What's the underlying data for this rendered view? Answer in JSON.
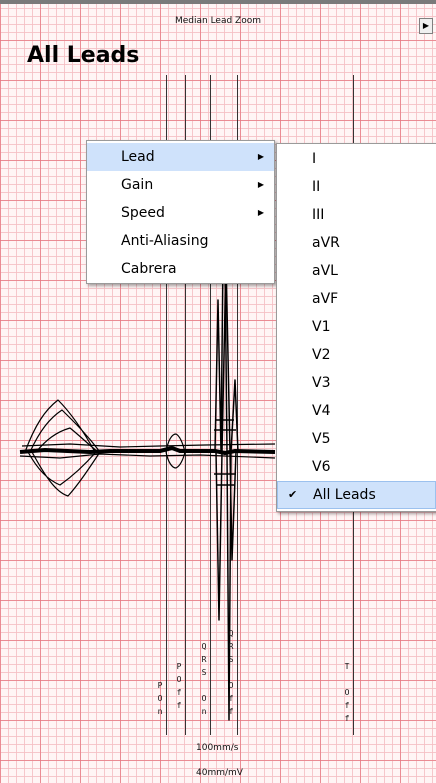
{
  "window": {
    "caption": "Median Lead Zoom",
    "nav_button": "▶",
    "title": "All Leads"
  },
  "markers": [
    {
      "id": "p-on",
      "label": "P\nO\nn"
    },
    {
      "id": "p-off",
      "label": "P\nO\nf\nf"
    },
    {
      "id": "qrs-on",
      "label": "Q\nR\nS\n\nO\nn"
    },
    {
      "id": "qrs-off",
      "label": "Q\nR\nS\n\nO\nf\nf"
    },
    {
      "id": "t-off",
      "label": "T\n\nO\nf\nf"
    }
  ],
  "scale": {
    "speed": "100mm/s",
    "gain": "40mm/mV"
  },
  "context_menu": {
    "items": [
      {
        "label": "Lead",
        "has_submenu": true,
        "selected": true
      },
      {
        "label": "Gain",
        "has_submenu": true,
        "selected": false
      },
      {
        "label": "Speed",
        "has_submenu": true,
        "selected": false
      },
      {
        "label": "Anti-Aliasing",
        "has_submenu": false,
        "selected": false
      },
      {
        "label": "Cabrera",
        "has_submenu": false,
        "selected": false
      }
    ]
  },
  "lead_submenu": {
    "items": [
      {
        "label": "I",
        "checked": false
      },
      {
        "label": "II",
        "checked": false
      },
      {
        "label": "III",
        "checked": false
      },
      {
        "label": "aVR",
        "checked": false
      },
      {
        "label": "aVL",
        "checked": false
      },
      {
        "label": "aVF",
        "checked": false
      },
      {
        "label": "V1",
        "checked": false
      },
      {
        "label": "V2",
        "checked": false
      },
      {
        "label": "V3",
        "checked": false
      },
      {
        "label": "V4",
        "checked": false
      },
      {
        "label": "V5",
        "checked": false
      },
      {
        "label": "V6",
        "checked": false
      },
      {
        "label": "All Leads",
        "checked": true
      }
    ]
  },
  "colors": {
    "grid_major": "#e67882",
    "grid_minor": "#f5bec3",
    "menu_highlight": "#cfe2fb"
  }
}
